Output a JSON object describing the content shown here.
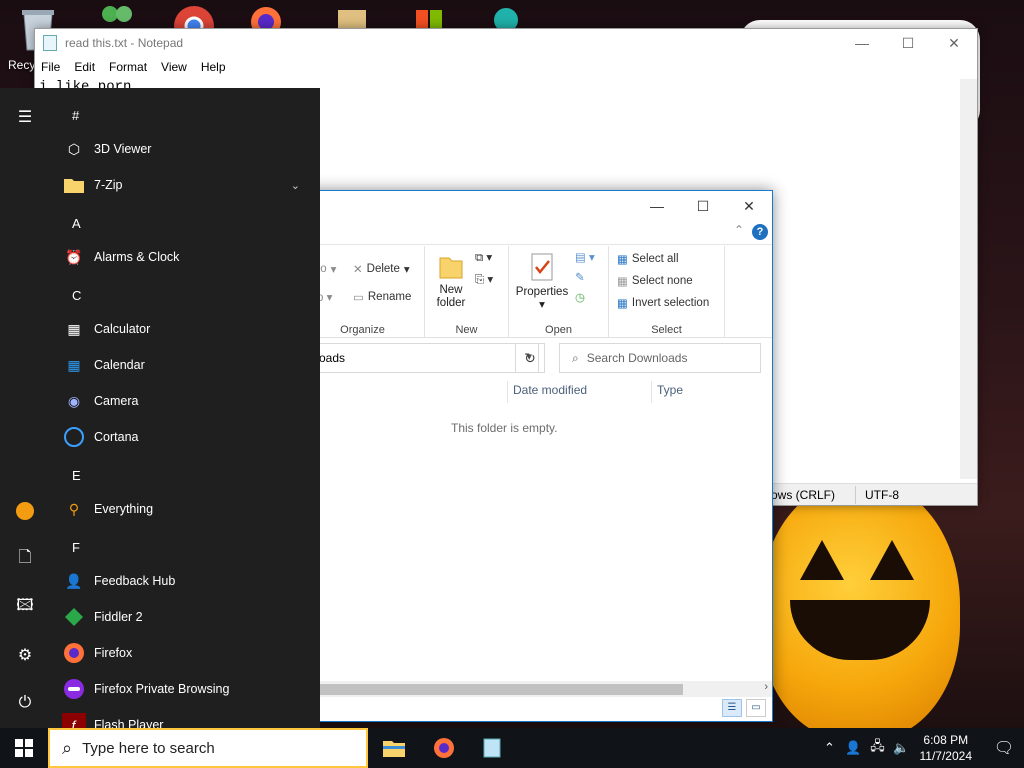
{
  "desktop": {
    "recycle_label": "Recy"
  },
  "notepad": {
    "title": "read this.txt - Notepad",
    "menu": [
      "File",
      "Edit",
      "Format",
      "View",
      "Help"
    ],
    "text": "i like porn",
    "status_line_ending": "ows (CRLF)",
    "status_encoding": "UTF-8"
  },
  "explorer": {
    "ribbon": {
      "to_label": "to",
      "delete_label": "Delete",
      "rename_label": "Rename",
      "organize_label": "Organize",
      "new_folder_label_1": "New",
      "new_folder_label_2": "folder",
      "new_label": "New",
      "properties_label": "Properties",
      "open_label": "Open",
      "select_all": "Select all",
      "select_none": "Select none",
      "invert_selection": "Invert selection",
      "select_label": "Select"
    },
    "address": "oads",
    "search_placeholder": "Search Downloads",
    "columns": {
      "date_modified": "Date modified",
      "type": "Type"
    },
    "empty_text": "This folder is empty."
  },
  "startmenu": {
    "sections": [
      {
        "letter": "#"
      },
      {
        "letter": "A"
      },
      {
        "letter": "C"
      },
      {
        "letter": "E"
      },
      {
        "letter": "F"
      }
    ],
    "apps": [
      {
        "label": "3D Viewer"
      },
      {
        "label": "7-Zip"
      },
      {
        "label": "Alarms & Clock"
      },
      {
        "label": "Calculator"
      },
      {
        "label": "Calendar"
      },
      {
        "label": "Camera"
      },
      {
        "label": "Cortana"
      },
      {
        "label": "Everything"
      },
      {
        "label": "Feedback Hub"
      },
      {
        "label": "Fiddler 2"
      },
      {
        "label": "Firefox"
      },
      {
        "label": "Firefox Private Browsing"
      },
      {
        "label": "Flash Player"
      }
    ]
  },
  "taskbar": {
    "search_placeholder": "Type here to search",
    "time": "6:08 PM",
    "date": "11/7/2024"
  },
  "colors": {
    "startmenu_bg": "#1f1f1f",
    "taskbar_bg": "#101418",
    "search_border": "#ffc83d",
    "accent": "#1e70c1"
  }
}
